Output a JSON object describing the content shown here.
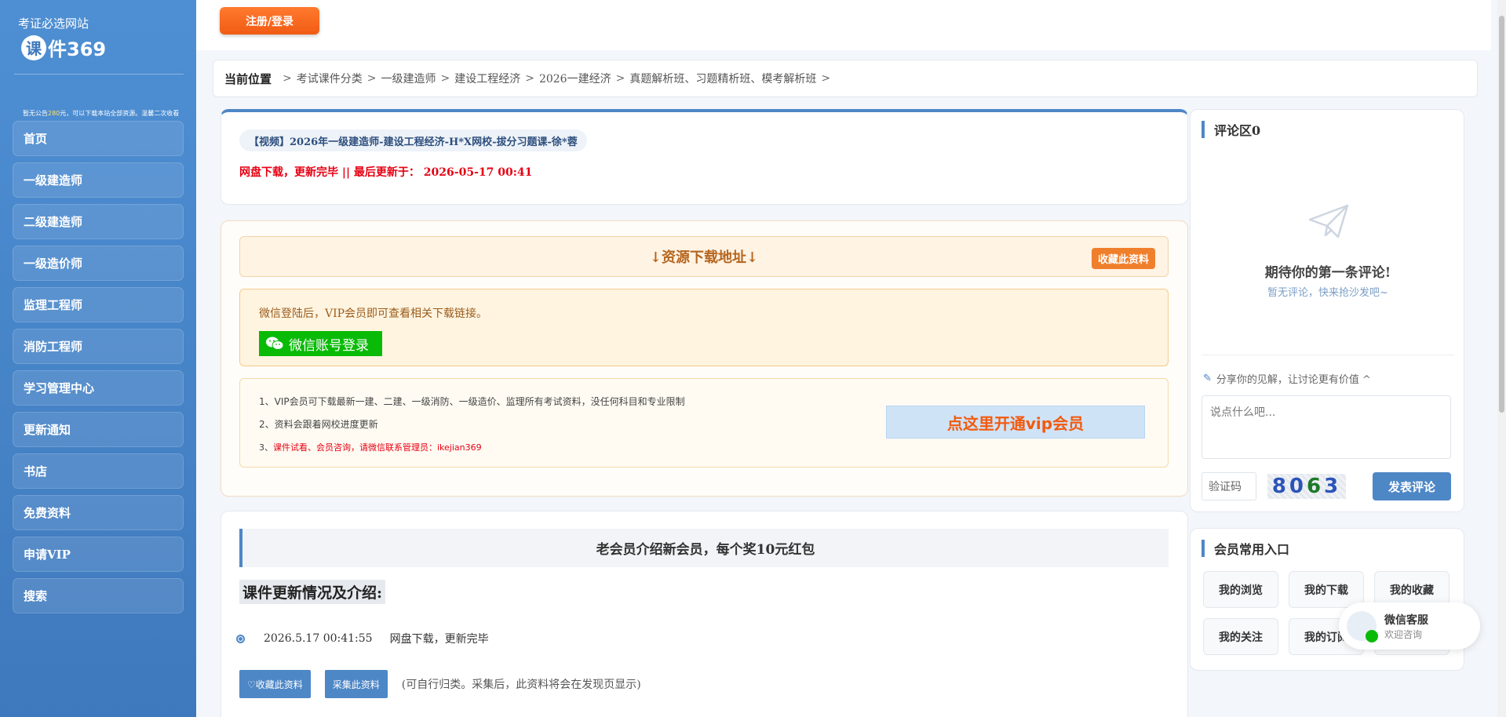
{
  "sidebar": {
    "tagline": "考证必选网站",
    "logo_char": "课",
    "logo_text": "件369",
    "notice_a": "暂无公告",
    "notice_hl": "280",
    "notice_b": "元，可以下载本站全部资源。温馨二次收看",
    "items": [
      {
        "label": "首页"
      },
      {
        "label": "一级建造师"
      },
      {
        "label": "二级建造师"
      },
      {
        "label": "一级造价师"
      },
      {
        "label": "监理工程师"
      },
      {
        "label": "消防工程师"
      },
      {
        "label": "学习管理中心"
      },
      {
        "label": "更新通知"
      },
      {
        "label": "书店"
      },
      {
        "label": "免费资料"
      },
      {
        "label": "申请VIP"
      },
      {
        "label": "搜索"
      }
    ]
  },
  "topbar": {
    "register_label": "注册/登录"
  },
  "breadcrumb": {
    "current_label": "当前位置",
    "crumbs": [
      "考试课件分类",
      "一级建造师",
      "建设工程经济",
      "2026一建经济",
      "真题解析班、习题精析班、模考解析班"
    ],
    "sep": ">"
  },
  "article": {
    "title": "【视频】2026年一级建造师-建设工程经济-H*X网校-拔分习题课-徐*蓉",
    "update_line": "网盘下载，更新完毕 || 最后更新于： 2026-05-17 00:41"
  },
  "resource": {
    "header": "↓资源下载地址↓",
    "fav_label": "收藏此资料",
    "login_tip": "微信登陆后，VIP会员即可查看相关下载链接。",
    "wx_login_label": "微信账号登录",
    "vip_lines": [
      "1、VIP会员可下载最新一建、二建、一级消防、一级造价、监理所有考试资料，没任何科目和专业限制",
      "2、资料会跟着网校进度更新"
    ],
    "vip_line3_prefix": "3、",
    "vip_line3_red": "课件试看、会员咨询，请微信联系管理员：ikejian369",
    "vip_open_label": "点这里开通vip会员"
  },
  "intro": {
    "promo": "老会员介绍新会员，每个奖10元红包",
    "title": "课件更新情况及介绍:",
    "log_time": "2026.5.17 00:41:55",
    "log_text": "网盘下载，更新完毕",
    "fav_btn": "♡收藏此资料",
    "collect_btn": "采集此资料",
    "note": "(可自行归类。采集后，此资料将会在发现页显示)"
  },
  "comments": {
    "title": "评论区0",
    "empty_title": "期待你的第一条评论!",
    "empty_sub": "暂无评论，快来抢沙发吧~",
    "prompt": "分享你的见解，让讨论更有价值 ^",
    "textarea_placeholder": "说点什么吧...",
    "captcha_placeholder": "验证码",
    "captcha_digits": [
      "80",
      "6",
      "3"
    ],
    "post_label": "发表评论"
  },
  "member": {
    "title": "会员常用入口",
    "items": [
      "我的浏览",
      "我的下载",
      "我的收藏",
      "我的关注",
      "我的订阅",
      ""
    ]
  },
  "service": {
    "title": "微信客服",
    "sub": "欢迎咨询"
  },
  "colors": {
    "accent": "#4e87c6",
    "sidebar": "#4a86c8",
    "orange": "#f15b14",
    "red": "#e60012",
    "wechat": "#09bb07"
  }
}
